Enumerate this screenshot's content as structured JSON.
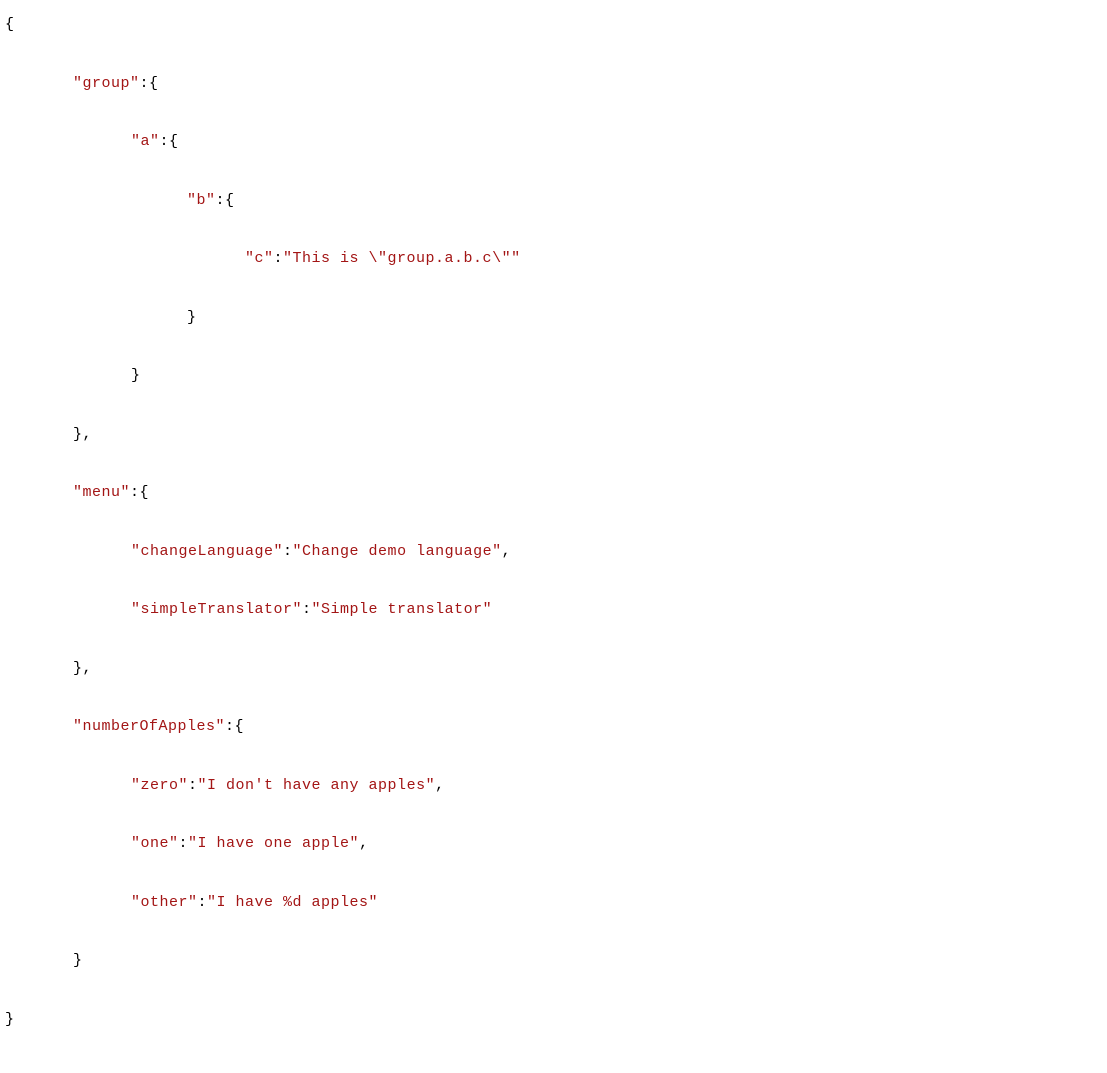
{
  "code": {
    "l0": "{",
    "l1a": "\"group\"",
    "l1b": ":{",
    "l2a": "\"a\"",
    "l2b": ":{",
    "l3a": "\"b\"",
    "l3b": ":{",
    "l4a": "\"c\"",
    "l4b": ":",
    "l4c": "\"This is \\\"group.a.b.c\\\"\"",
    "l5": "}",
    "l6": "}",
    "l7": "},",
    "l8a": "\"menu\"",
    "l8b": ":{",
    "l9a": "\"changeLanguage\"",
    "l9b": ":",
    "l9c": "\"Change demo language\"",
    "l9d": ",",
    "l10a": "\"simpleTranslator\"",
    "l10b": ":",
    "l10c": "\"Simple translator\"",
    "l11": "},",
    "l12a": "\"numberOfApples\"",
    "l12b": ":{",
    "l13a": "\"zero\"",
    "l13b": ":",
    "l13c": "\"I don't have any apples\"",
    "l13d": ",",
    "l14a": "\"one\"",
    "l14b": ":",
    "l14c": "\"I have one apple\"",
    "l14d": ",",
    "l15a": "\"other\"",
    "l15b": ":",
    "l15c": "\"I have %d apples\"",
    "l16": "}",
    "l17": "}"
  }
}
